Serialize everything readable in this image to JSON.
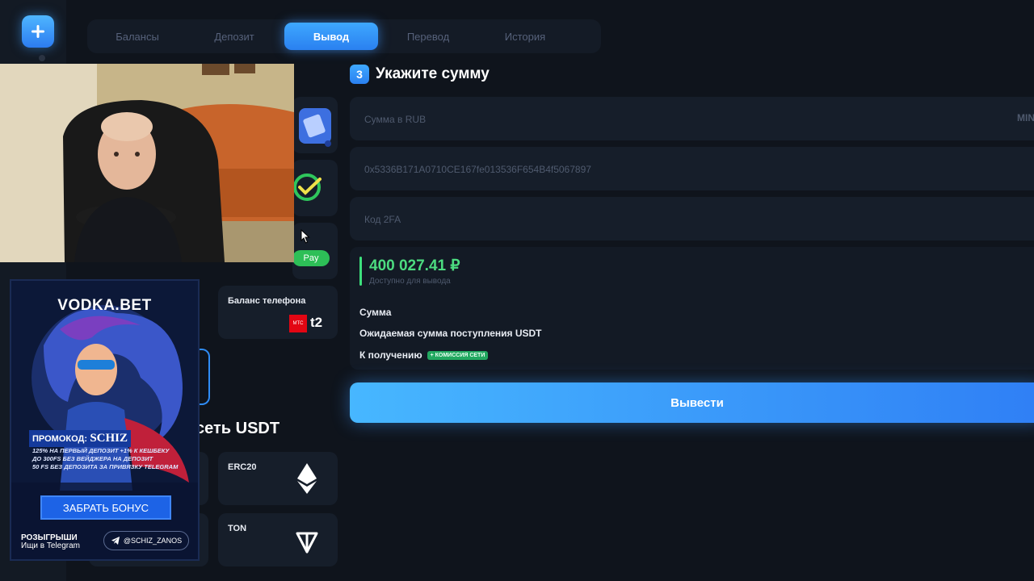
{
  "tabs": [
    "Балансы",
    "Депозит",
    "Вывод",
    "Перевод",
    "История"
  ],
  "section": {
    "step": "3",
    "title": "Укажите сумму"
  },
  "form": {
    "amount_placeholder": "Сумма в RUB",
    "min_label": "MIN",
    "address_value": "0x5336B171A0710CE167fe013536F654B4f5067897",
    "twofa_placeholder": "Код 2FA"
  },
  "balance": {
    "amount": "400 027.41 ₽",
    "caption": "Доступно для вывода"
  },
  "summary": {
    "sum_label": "Сумма",
    "expected_label": "Ожидаемая сумма поступления USDT",
    "receive_label": "К получению",
    "fee_badge": "+ КОМИССИЯ СЕТИ"
  },
  "withdraw_button": "Вывести",
  "methods": {
    "pay_label": "Pay",
    "phone_balance_label": "Баланс телефона",
    "mts_label": "МТС",
    "t2_label": "t2",
    "network_title": "сеть USDT",
    "erc20_label": "ERC20",
    "ton_label": "TON"
  },
  "promo": {
    "logo": "VODKA.BET",
    "promo_prefix": "ПРОМОКОД:",
    "promo_code": "SCHIZ",
    "line1": "125% НА ПЕРВЫЙ ДЕПОЗИТ +1% К КЕШБЕКУ",
    "line2": "ДО 300FS БЕЗ ВЕЙДЖЕРА НА ДЕПОЗИТ",
    "line3": "50 FS БЕЗ ДЕПОЗИТА ЗА ПРИВЯЗКУ TELEGRAM",
    "bonus_button": "ЗАБРАТЬ БОНУС",
    "footer_line1": "РОЗЫГРЫШИ",
    "footer_line2": "Ищи в Telegram",
    "telegram_handle": "@SCHIZ_ZANOS"
  },
  "colors": {
    "accent": "#3ea8ff",
    "background": "#0f141c",
    "success": "#4cdc80"
  }
}
